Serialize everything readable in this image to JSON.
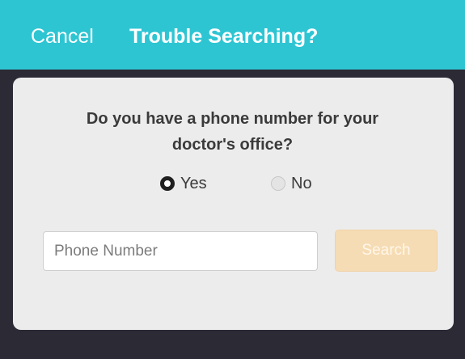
{
  "header": {
    "cancel_label": "Cancel",
    "title": "Trouble Searching?"
  },
  "dialog": {
    "question_line1": "Do you have a phone number for your",
    "question_line2": "doctor's office?",
    "options": [
      {
        "label": "Yes",
        "selected": true
      },
      {
        "label": "No",
        "selected": false
      }
    ],
    "phone_input": {
      "value": "",
      "placeholder": "Phone Number"
    },
    "search_label": "Search",
    "search_enabled": false
  },
  "colors": {
    "header_bg": "#2ec5d3",
    "backdrop": "#2b2a35",
    "card_bg": "#ececec",
    "search_disabled_bg": "#f6dcb4"
  }
}
